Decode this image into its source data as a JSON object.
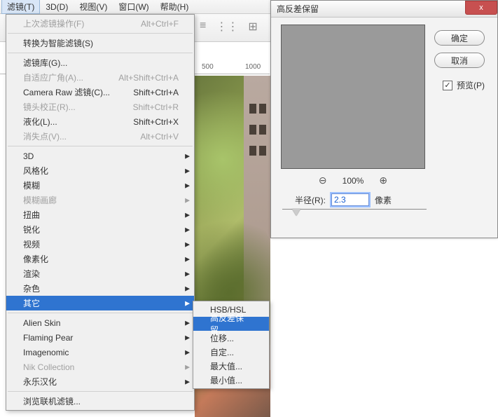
{
  "menubar": {
    "items": [
      {
        "label": "滤镜(T)",
        "active": true
      },
      {
        "label": "3D(D)"
      },
      {
        "label": "视图(V)"
      },
      {
        "label": "窗口(W)"
      },
      {
        "label": "帮助(H)"
      }
    ]
  },
  "ruler": {
    "m500": "500",
    "m1000": "1000"
  },
  "filter_menu": {
    "items": [
      {
        "label": "上次滤镜操作(F)",
        "shortcut": "Alt+Ctrl+F",
        "disabled": true
      },
      {
        "sep": true
      },
      {
        "label": "转换为智能滤镜(S)"
      },
      {
        "sep": true
      },
      {
        "label": "滤镜库(G)..."
      },
      {
        "label": "自适应广角(A)...",
        "shortcut": "Alt+Shift+Ctrl+A",
        "disabled": true
      },
      {
        "label": "Camera Raw 滤镜(C)...",
        "shortcut": "Shift+Ctrl+A"
      },
      {
        "label": "镜头校正(R)...",
        "shortcut": "Shift+Ctrl+R",
        "disabled": true
      },
      {
        "label": "液化(L)...",
        "shortcut": "Shift+Ctrl+X"
      },
      {
        "label": "消失点(V)...",
        "shortcut": "Alt+Ctrl+V",
        "disabled": true
      },
      {
        "sep": true
      },
      {
        "label": "3D",
        "sub": true
      },
      {
        "label": "风格化",
        "sub": true
      },
      {
        "label": "模糊",
        "sub": true
      },
      {
        "label": "模糊画廊",
        "sub": true,
        "disabled": true
      },
      {
        "label": "扭曲",
        "sub": true
      },
      {
        "label": "锐化",
        "sub": true
      },
      {
        "label": "视频",
        "sub": true
      },
      {
        "label": "像素化",
        "sub": true
      },
      {
        "label": "渲染",
        "sub": true
      },
      {
        "label": "杂色",
        "sub": true
      },
      {
        "label": "其它",
        "sub": true,
        "highlight": true
      },
      {
        "sep": true
      },
      {
        "label": "Alien Skin",
        "sub": true
      },
      {
        "label": "Flaming Pear",
        "sub": true
      },
      {
        "label": "Imagenomic",
        "sub": true
      },
      {
        "label": "Nik Collection",
        "sub": true,
        "disabled": true
      },
      {
        "label": "永乐汉化",
        "sub": true
      },
      {
        "sep": true
      },
      {
        "label": "浏览联机滤镜..."
      }
    ]
  },
  "submenu": {
    "items": [
      {
        "label": "HSB/HSL"
      },
      {
        "label": "高反差保留...",
        "highlight": true
      },
      {
        "label": "位移..."
      },
      {
        "label": "自定..."
      },
      {
        "label": "最大值..."
      },
      {
        "label": "最小值..."
      }
    ]
  },
  "dialog": {
    "title": "高反差保留",
    "close": "x",
    "ok": "确定",
    "cancel": "取消",
    "preview_label": "预览(P)",
    "preview_checked": "✓",
    "zoom_out": "⊖",
    "zoom_pct": "100%",
    "zoom_in": "⊕",
    "radius_label": "半径(R):",
    "radius_value": "2.3",
    "radius_unit": "像素"
  }
}
